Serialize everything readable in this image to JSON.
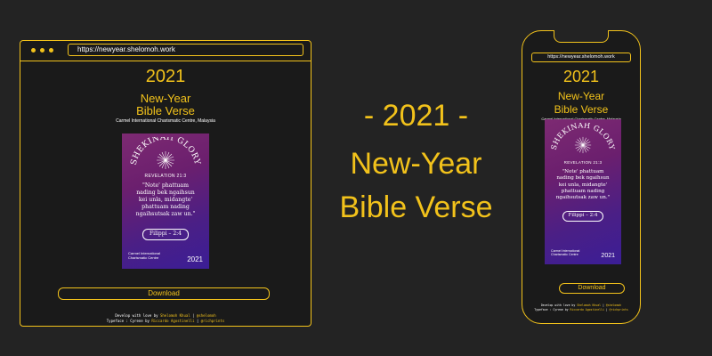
{
  "browser": {
    "url": "https://newyear.shelomoh.work",
    "year": "2021",
    "title_line1": "New-Year",
    "title_line2": "Bible Verse",
    "church": "Carmel International Charismatic Centre, Malaysia",
    "download_label": "Download",
    "credits_line1_pre": "Develop with love by ",
    "credits_author": "Shelomoh Khual",
    "credits_sep1": " | ",
    "credits_handle1": "@shelomoh",
    "credits_line2_pre": "Typeface : Cyrene by ",
    "credits_type_author": "Riccardo Agostinelli",
    "credits_sep2": " | ",
    "credits_handle2": "@richprints"
  },
  "poster": {
    "arc_title": "SHEKINAH GLORY",
    "reference": "REVELATION 21:3",
    "verse_lines": [
      "\"Note' phattuam",
      "nading bek ngaihsun",
      "kei unla, midangte'",
      "phattuam nading",
      "ngaihsutsak zaw un.\""
    ],
    "pill": "Filippi – 2:4",
    "church_line1": "Carmel International",
    "church_line2": "Charismatic Centre",
    "year": "2021"
  },
  "center": {
    "line1": "- 2021 -",
    "line2": "New-Year",
    "line3": "Bible Verse"
  },
  "phone": {
    "url": "https://newyear.shelomoh.work",
    "year": "2021",
    "title_line1": "New-Year",
    "title_line2": "Bible Verse",
    "church": "Carmel International Charismatic Centre, Malaysia",
    "download_label": "Download"
  },
  "colors": {
    "accent": "#f2c21b",
    "background": "#232323",
    "poster_gradient": [
      "#7d2a72",
      "#3b1e96"
    ]
  }
}
